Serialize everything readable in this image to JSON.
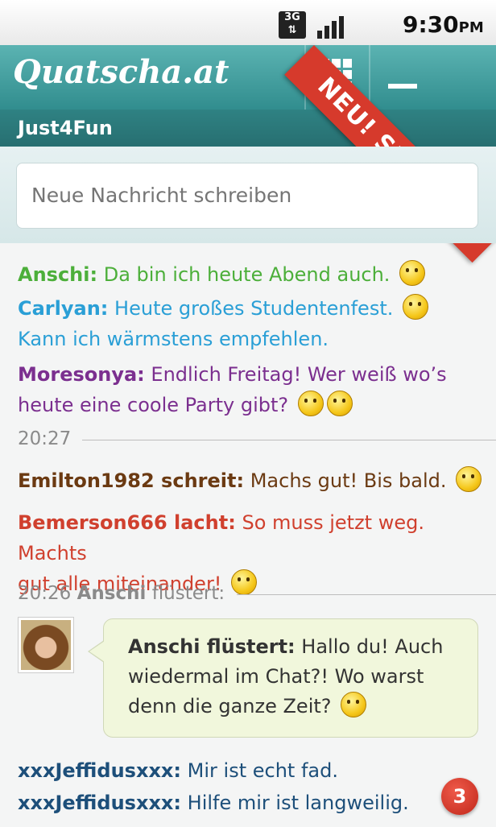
{
  "status_bar": {
    "network": "3G",
    "time": "9:30",
    "ampm": "PM"
  },
  "header": {
    "app_name": "Quatscha.at",
    "channel": "Just4Fun",
    "grid_icon": "grid-icon",
    "menu_icon": "menu-icon"
  },
  "promo": {
    "ribbon_text": "NEU! SMILEYS",
    "ribbon_color": "#d63a2c"
  },
  "compose": {
    "placeholder": "Neue Nachricht schreiben"
  },
  "messages": [
    {
      "user": "Anschi:",
      "text": "Da bin ich heute Abend auch.",
      "color": "#4caf3a"
    },
    {
      "user": "Carlyan:",
      "text": "Heute großes Studentenfest.",
      "text2": "Kann ich wärmstens empfehlen.",
      "color": "#2a9fd6"
    },
    {
      "user": "Moresonya:",
      "text": "Endlich Freitag! Wer weiß wo’s",
      "text2": "heute eine coole Party gibt?",
      "color": "#7b2f8f"
    },
    {
      "user": "Emilton1982 schreit:",
      "text": "Machs gut! Bis bald.",
      "color": "#6b3a12"
    },
    {
      "user": "Bemerson666 lacht:",
      "text": "So muss jetzt weg. Machts",
      "text2": "gut alle miteinander!",
      "color": "#d0402e"
    },
    {
      "user": "xxxJeffidusxxx:",
      "text": "Mir ist echt fad.",
      "color": "#1d4f7a"
    },
    {
      "user": "xxxJeffidusxxx:",
      "text": "Hilfe mir ist langweilig.",
      "color": "#1d4f7a"
    }
  ],
  "timestamps": {
    "first": "20:27",
    "second_time": "20:26",
    "second_user": "Anschi",
    "second_action": "flüstert:"
  },
  "whisper": {
    "sender": "Anschi flüstert:",
    "line1": "Hallo du! Auch",
    "line2": "wiedermal im Chat?! Wo warst",
    "line3": "denn die ganze Zeit?"
  },
  "notification_badge": {
    "count": "3",
    "color": "#c0271a"
  }
}
